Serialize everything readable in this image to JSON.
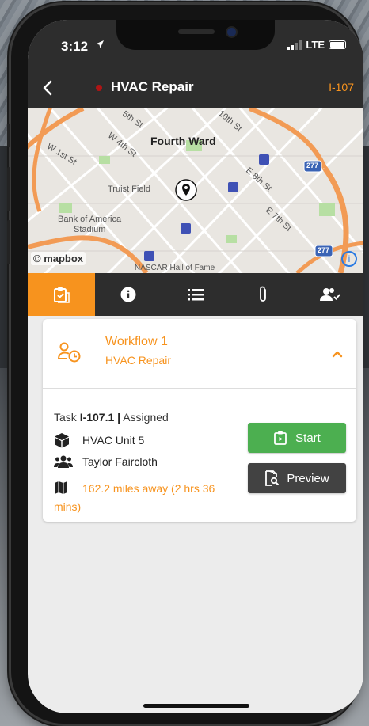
{
  "status_bar": {
    "time": "3:12",
    "carrier": "LTE"
  },
  "app_bar": {
    "title": "HVAC Repair",
    "code": "I-107"
  },
  "map": {
    "labels": {
      "area": "Fourth Ward",
      "w_4th": "W 4th St",
      "w_1st": "W 1st St",
      "w_5th": "5th St",
      "st_10th": "10th St",
      "e_8th": "E 8th St",
      "e_7th": "E 7th St",
      "truist": "Truist Field",
      "boa": "Bank of America",
      "stadium": "Stadium",
      "nascar": "NASCAR Hall of Fame",
      "hwy_277": "277",
      "hwy_277b": "277"
    },
    "attribution": "© mapbox",
    "info_glyph": "i"
  },
  "tabs": [
    {
      "name": "task-icon",
      "active": true
    },
    {
      "name": "info-icon",
      "active": false
    },
    {
      "name": "list-icon",
      "active": false
    },
    {
      "name": "attachment-icon",
      "active": false
    },
    {
      "name": "users-icon",
      "active": false
    }
  ],
  "workflow": {
    "title": "Workflow 1",
    "subtitle": "HVAC Repair",
    "task_label": "Task ",
    "task_id": "I-107.1 |",
    "task_status": " Assigned",
    "asset": "HVAC Unit 5",
    "assignee": "Taylor Faircloth",
    "distance": "162.2 miles away (2 hrs 36 mins)",
    "start_label": "Start",
    "preview_label": "Preview"
  },
  "colors": {
    "accent": "#f7931e",
    "start": "#4caf50",
    "preview": "#424242",
    "bar": "#2d2d2d",
    "status_dot": "#b01515"
  }
}
